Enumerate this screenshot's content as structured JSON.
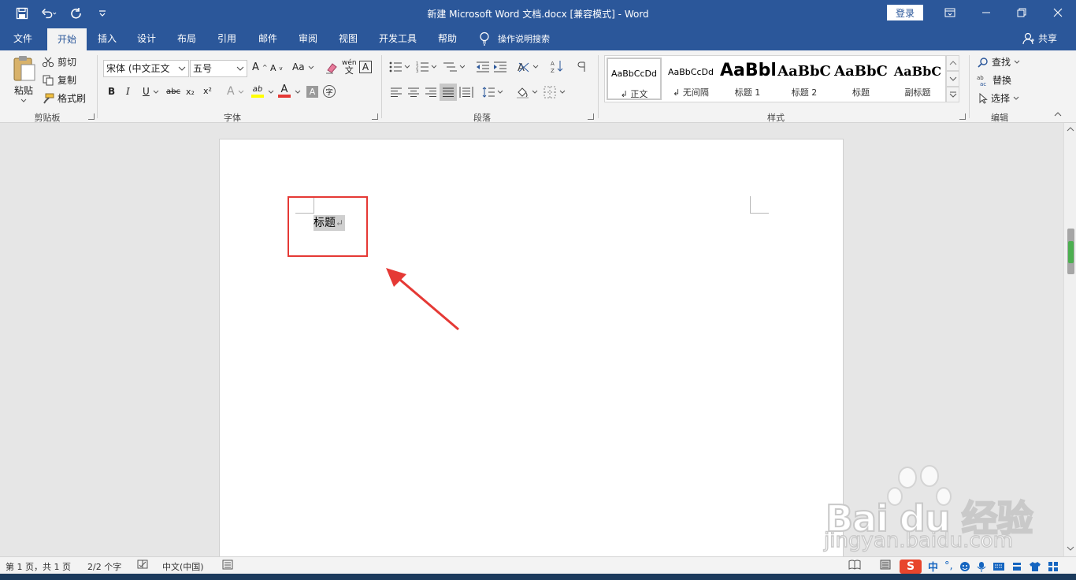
{
  "titlebar": {
    "title": "新建 Microsoft Word 文档.docx [兼容模式] - Word",
    "login": "登录"
  },
  "tabs": [
    {
      "label": "文件"
    },
    {
      "label": "开始"
    },
    {
      "label": "插入"
    },
    {
      "label": "设计"
    },
    {
      "label": "布局"
    },
    {
      "label": "引用"
    },
    {
      "label": "邮件"
    },
    {
      "label": "审阅"
    },
    {
      "label": "视图"
    },
    {
      "label": "开发工具"
    },
    {
      "label": "帮助"
    }
  ],
  "tellme": "操作说明搜索",
  "share": "共享",
  "clipboard": {
    "paste": "粘贴",
    "cut": "剪切",
    "copy": "复制",
    "format_painter": "格式刷",
    "label": "剪贴板"
  },
  "font": {
    "name": "宋体 (中文正文",
    "size": "五号",
    "label": "字体",
    "grow": "A",
    "shrink": "A",
    "case": "Aa",
    "phonetic": "wén",
    "border_char": "A",
    "bold": "B",
    "italic": "I",
    "underline": "U",
    "strike": "abc",
    "subscript": "x₂",
    "superscript": "x²",
    "effects": "A",
    "highlight": "ab",
    "color": "A",
    "shading": "A",
    "enclose": "字"
  },
  "paragraph": {
    "label": "段落"
  },
  "styles": {
    "label": "样式",
    "items": [
      {
        "sample": "AaBbCcDd",
        "name": "↲ 正文"
      },
      {
        "sample": "AaBbCcDd",
        "name": "↲ 无间隔"
      },
      {
        "sample": "AaBbl",
        "name": "标题 1"
      },
      {
        "sample": "AaBbC",
        "name": "标题 2"
      },
      {
        "sample": "AaBbC",
        "name": "标题"
      },
      {
        "sample": "AaBbC",
        "name": "副标题"
      }
    ]
  },
  "editing": {
    "find": "查找",
    "replace": "替换",
    "select": "选择",
    "label": "编辑"
  },
  "document": {
    "text": "标题",
    "para_mark": "↵"
  },
  "watermark": {
    "brand": "Bai du 经验",
    "url": "jingyan.baidu.com"
  },
  "statusbar": {
    "page": "第 1 页，共 1 页",
    "words": "2/2 个字",
    "language": "中文(中国)",
    "ime": "中"
  },
  "colors": {
    "brand": "#2b579a",
    "annotation": "#e53935"
  }
}
